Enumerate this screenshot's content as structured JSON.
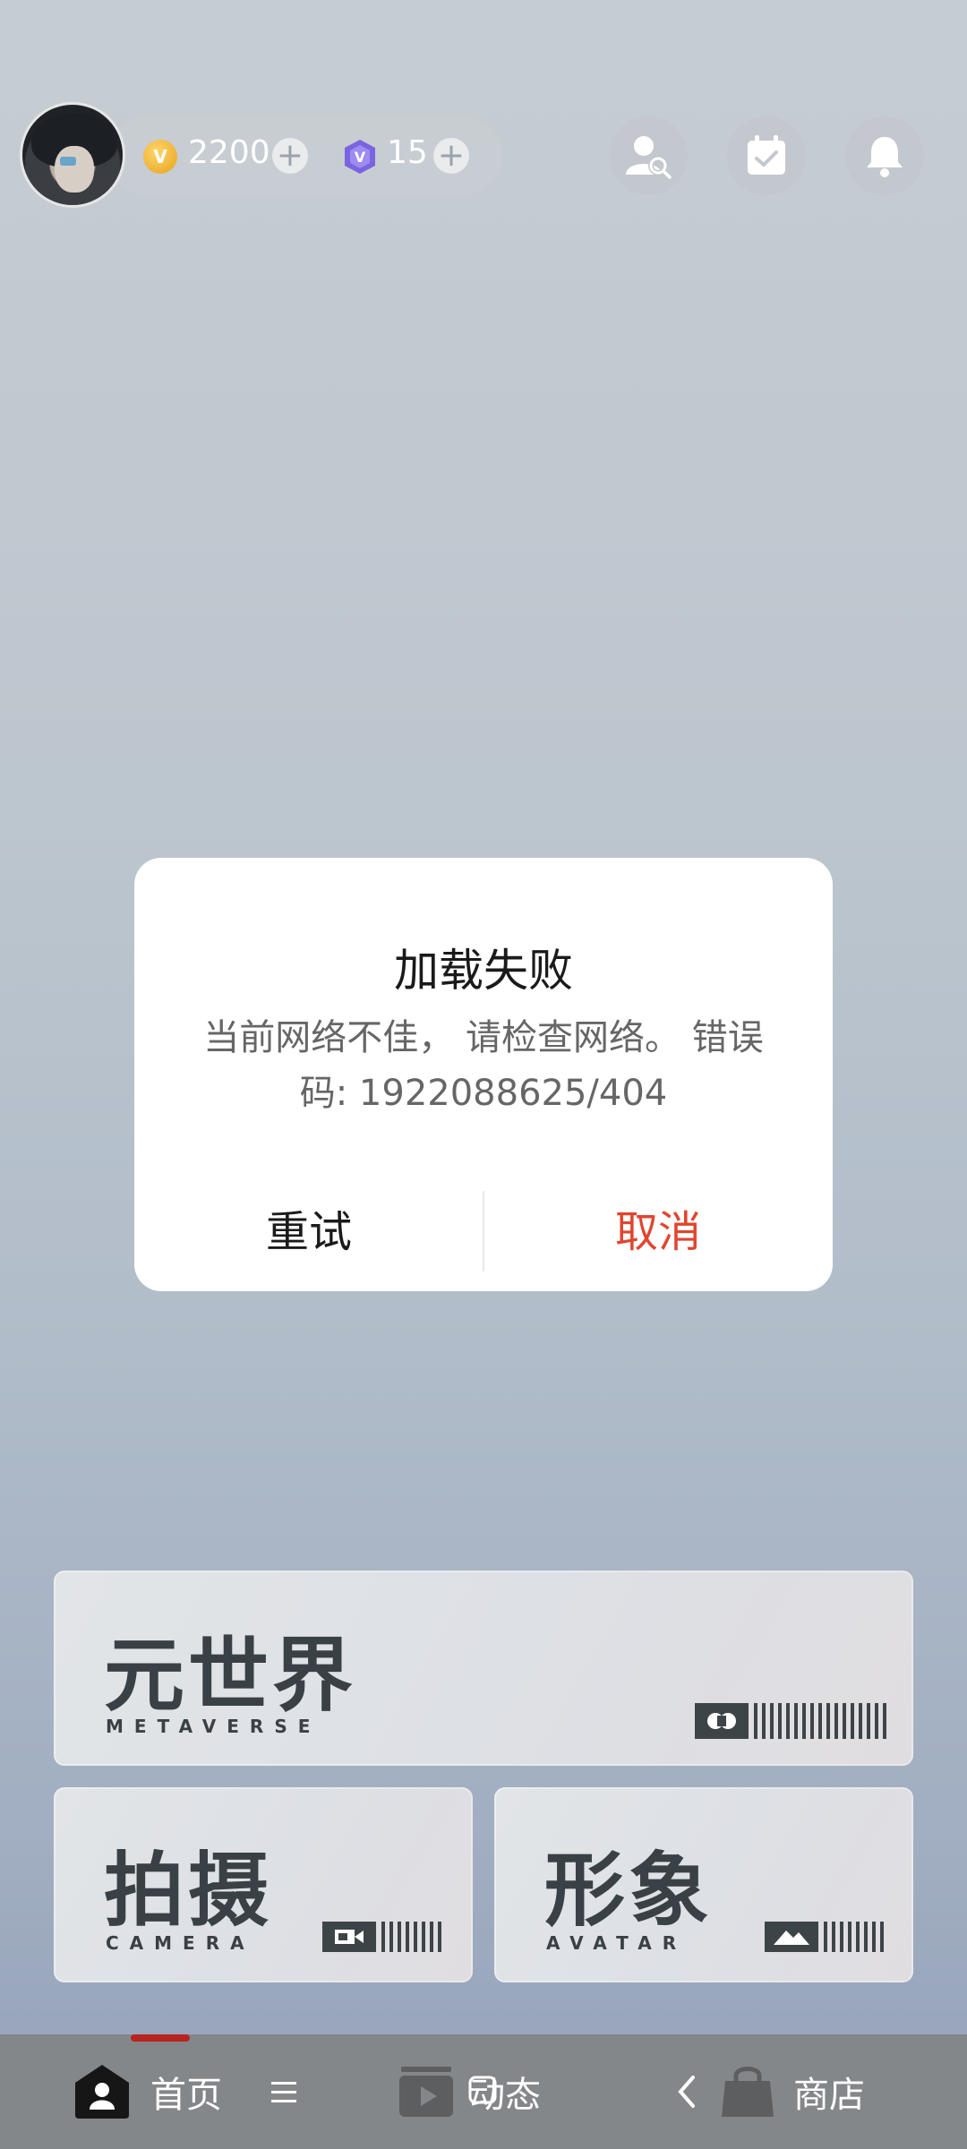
{
  "header": {
    "coins": "2200",
    "gems": "15"
  },
  "dialog": {
    "title": "加载失败",
    "message": "当前网络不佳， 请检查网络。 错误码: 1922088625/404",
    "retry": "重试",
    "cancel": "取消"
  },
  "cards": {
    "metaverse": {
      "title": "元世界",
      "subtitle": "METAVERSE"
    },
    "camera": {
      "title": "拍摄",
      "subtitle": "CAMERA"
    },
    "avatar": {
      "title": "形象",
      "subtitle": "AVATAR"
    }
  },
  "nav": {
    "home": "首页",
    "feed": "动态",
    "shop": "商店"
  },
  "colors": {
    "accent_red": "#e0452f",
    "nav_indicator": "#b8241e"
  }
}
